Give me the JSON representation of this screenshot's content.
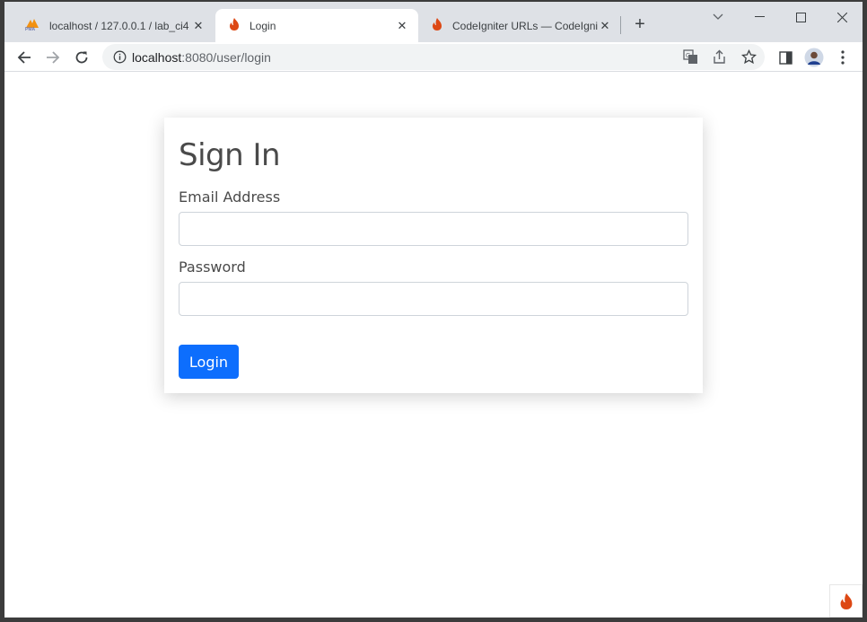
{
  "tabs": [
    {
      "title": "localhost / 127.0.0.1 / lab_ci4 / ",
      "icon": "phpmyadmin-icon",
      "active": false
    },
    {
      "title": "Login",
      "icon": "codeigniter-flame-icon",
      "active": true
    },
    {
      "title": "CodeIgniter URLs — CodeIgnit",
      "icon": "codeigniter-flame-icon",
      "active": false
    }
  ],
  "new_tab_label": "+",
  "address_bar": {
    "host": "localhost",
    "path": ":8080/user/login"
  },
  "page": {
    "heading": "Sign In",
    "email_label": "Email Address",
    "email_value": "",
    "password_label": "Password",
    "password_value": "",
    "login_button": "Login"
  },
  "colors": {
    "primary_button": "#0d6efd",
    "codeigniter_orange": "#dd4814",
    "tabstrip_bg": "#dee1e6"
  }
}
